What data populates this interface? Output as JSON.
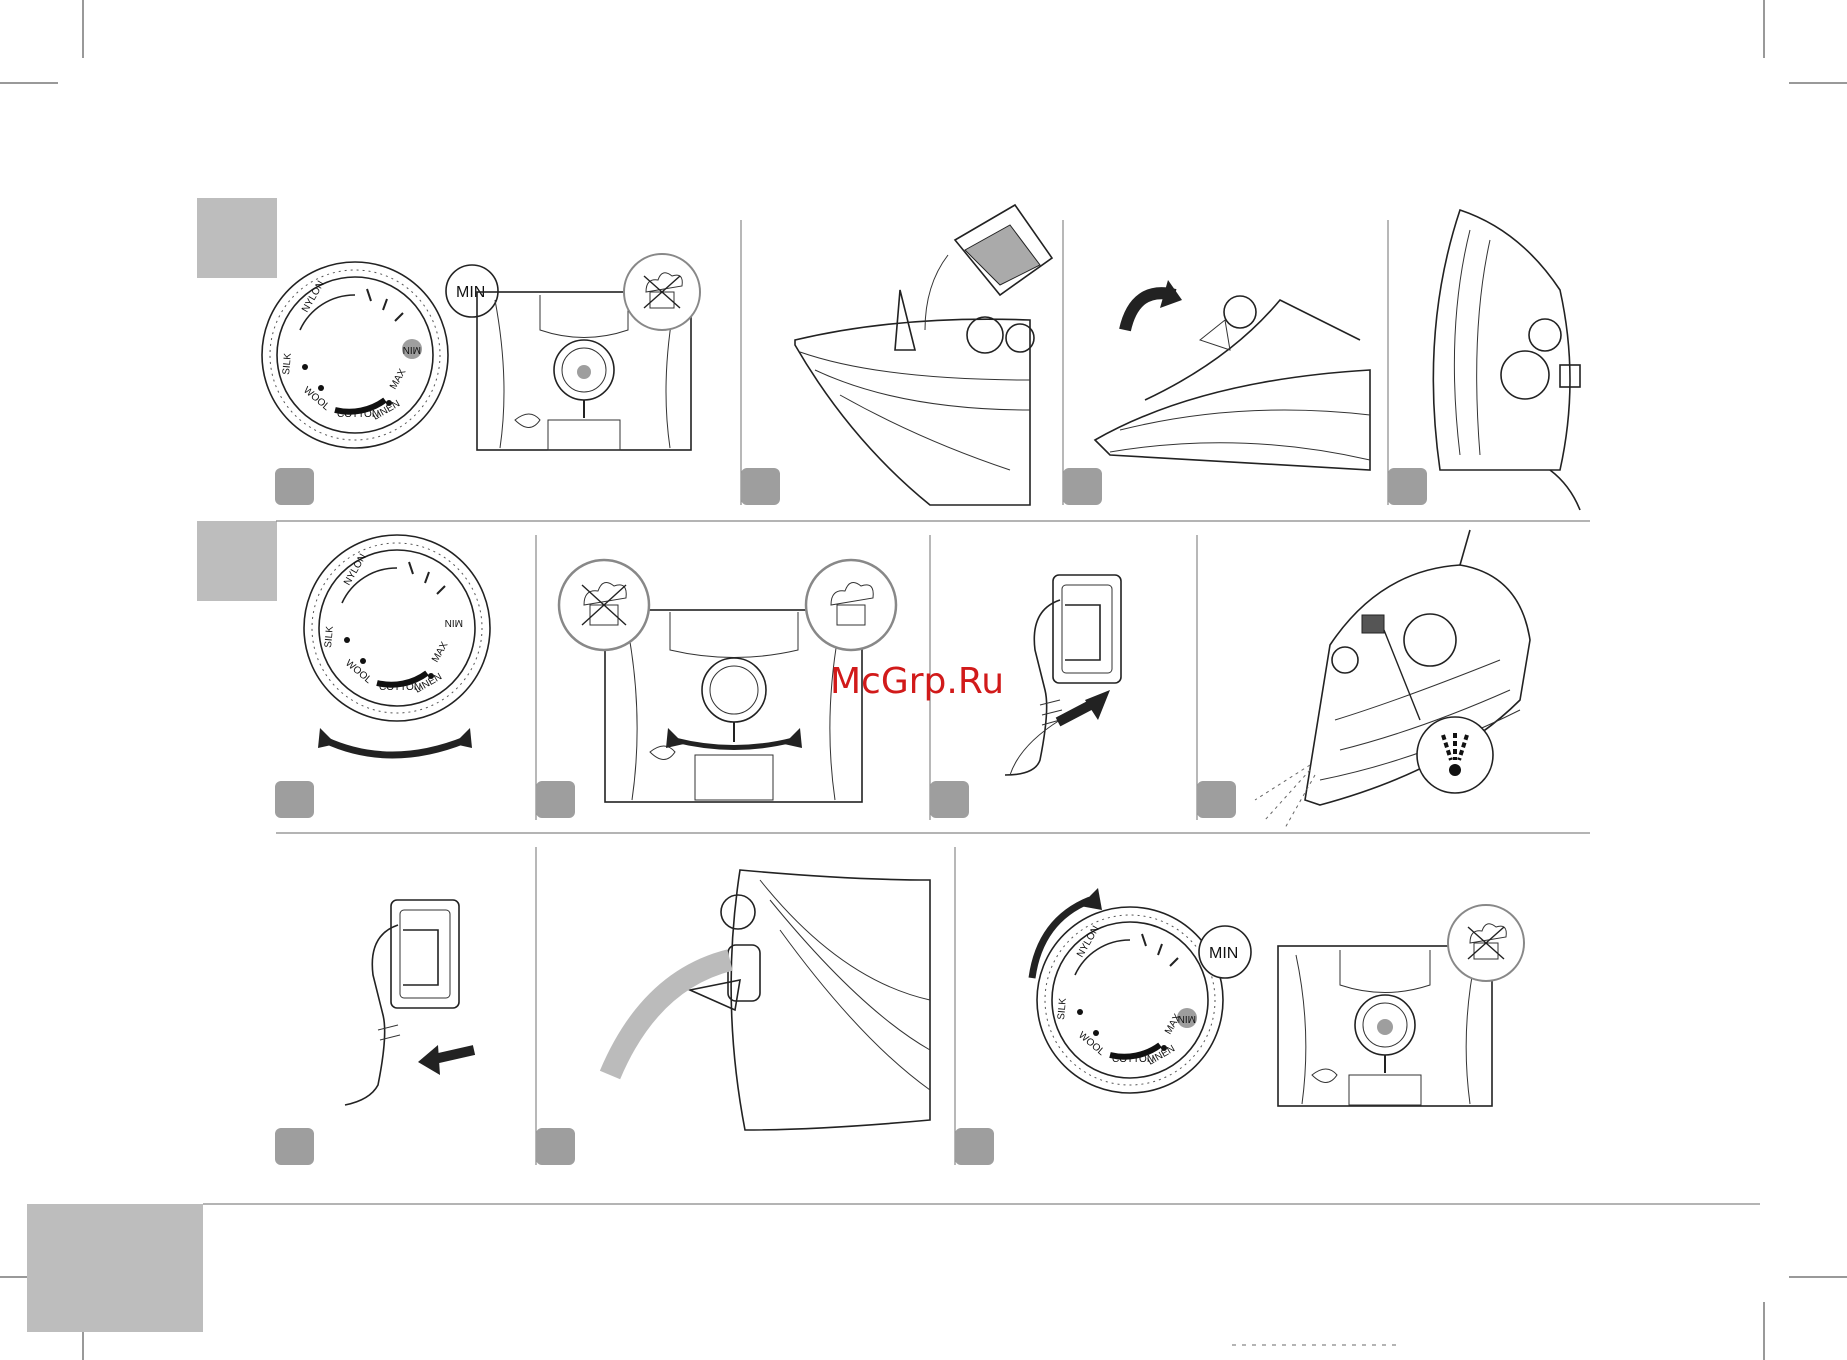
{
  "watermark": "McGrp.Ru",
  "dial": {
    "nylon": "NYLON",
    "silk": "SILK",
    "wool": "WOOL",
    "cotton": "COTTON",
    "linen": "LINEN",
    "max": "MAX",
    "min": "MIN"
  },
  "callout_min": "MIN",
  "colors": {
    "gray_block": "#bdbdbd",
    "step_badge": "#9e9e9e",
    "line": "#222222",
    "accent_red": "#d11a1a"
  },
  "steps": {
    "section1": [
      "step-badge",
      "step-badge",
      "step-badge",
      "step-badge"
    ],
    "section2": [
      "step-badge",
      "step-badge",
      "step-badge",
      "step-badge"
    ],
    "section3": [
      "step-badge",
      "step-badge",
      "step-badge"
    ]
  },
  "icons": [
    "temperature-dial-icon",
    "steam-off-icon",
    "steam-on-icon",
    "water-cup-icon",
    "iron-icon",
    "plug-socket-icon",
    "rotate-arrow-icon",
    "spray-burst-icon"
  ]
}
